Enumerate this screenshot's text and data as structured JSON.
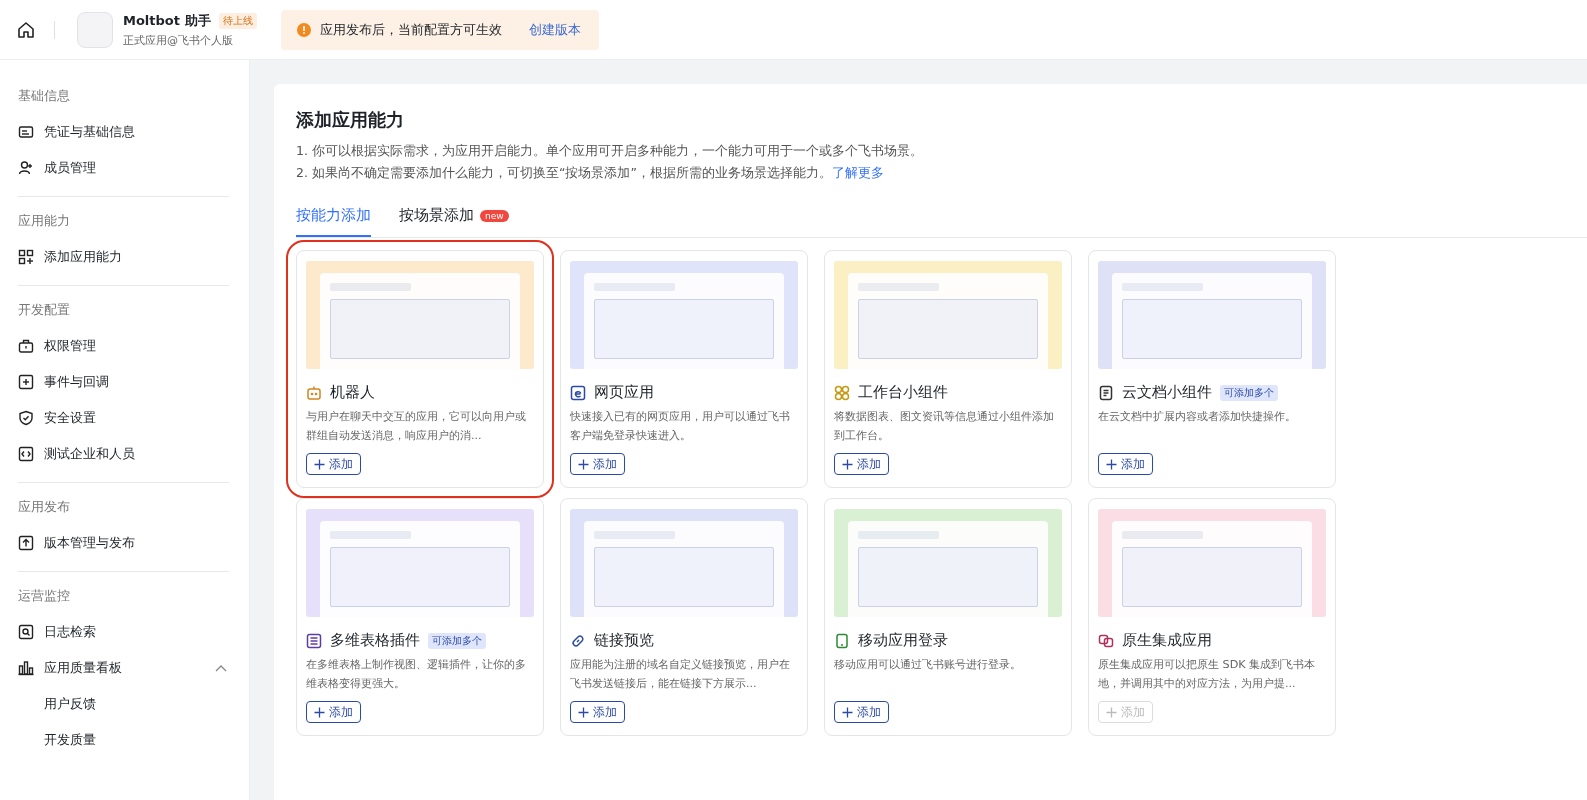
{
  "header": {
    "app_name": "Moltbot 助手",
    "status_badge": "待上线",
    "subtitle": "正式应用@飞书个人版",
    "notice": {
      "text": "应用发布后，当前配置方可生效",
      "link": "创建版本"
    }
  },
  "sidebar": {
    "groups": [
      {
        "heading": "基础信息",
        "items": [
          {
            "label": "凭证与基础信息"
          },
          {
            "label": "成员管理"
          }
        ]
      },
      {
        "heading": "应用能力",
        "items": [
          {
            "label": "添加应用能力"
          }
        ]
      },
      {
        "heading": "开发配置",
        "items": [
          {
            "label": "权限管理"
          },
          {
            "label": "事件与回调"
          },
          {
            "label": "安全设置"
          },
          {
            "label": "测试企业和人员"
          }
        ]
      },
      {
        "heading": "应用发布",
        "items": [
          {
            "label": "版本管理与发布"
          }
        ]
      },
      {
        "heading": "运营监控",
        "items": [
          {
            "label": "日志检索"
          },
          {
            "label": "应用质量看板",
            "expanded": true,
            "children": [
              {
                "label": "用户反馈"
              },
              {
                "label": "开发质量"
              }
            ]
          }
        ]
      }
    ]
  },
  "main": {
    "title": "添加应用能力",
    "notes": [
      "1. 你可以根据实际需求，为应用开启能力。单个应用可开启多种能力，一个能力可用于一个或多个飞书场景。",
      "2. 如果尚不确定需要添加什么能力，可切换至“按场景添加”，根据所需的业务场景选择能力。"
    ],
    "learn_more": "了解更多",
    "tabs": [
      {
        "label": "按能力添加",
        "selected": true
      },
      {
        "label": "按场景添加",
        "selected": false,
        "badge": "new"
      }
    ],
    "cards": [
      {
        "title": "机器人",
        "description": "与用户在聊天中交互的应用，它可以向用户或群组自动发送消息，响应用户的消...",
        "button": {
          "label": "添加",
          "disabled": false
        },
        "selected": true
      },
      {
        "title": "网页应用",
        "description": "快速接入已有的网页应用，用户可以通过飞书客户端免登录快速进入。",
        "button": {
          "label": "添加",
          "disabled": false
        },
        "selected": false
      },
      {
        "title": "工作台小组件",
        "description": "将数据图表、图文资讯等信息通过小组件添加到工作台。",
        "button": {
          "label": "添加",
          "disabled": false
        },
        "selected": false
      },
      {
        "title": "云文档小组件",
        "badge": "可添加多个",
        "description": "在云文档中扩展内容或者添加快捷操作。",
        "button": {
          "label": "添加",
          "disabled": false
        },
        "selected": false
      },
      {
        "title": "多维表格插件",
        "badge": "可添加多个",
        "description": "在多维表格上制作视图、逻辑插件，让你的多维表格变得更强大。",
        "button": {
          "label": "添加",
          "disabled": false
        },
        "selected": false
      },
      {
        "title": "链接预览",
        "description": "应用能为注册的域名自定义链接预览，用户在飞书发送链接后，能在链接下方展示...",
        "button": {
          "label": "添加",
          "disabled": false
        },
        "selected": false
      },
      {
        "title": "移动应用登录",
        "description": "移动应用可以通过飞书账号进行登录。",
        "button": {
          "label": "添加",
          "disabled": false
        },
        "selected": false
      },
      {
        "title": "原生集成应用",
        "description": "原生集成应用可以把原生 SDK 集成到飞书本地，并调用其中的对应方法，为用户提...",
        "button": {
          "label": "添加",
          "disabled": true
        },
        "selected": false
      }
    ]
  }
}
